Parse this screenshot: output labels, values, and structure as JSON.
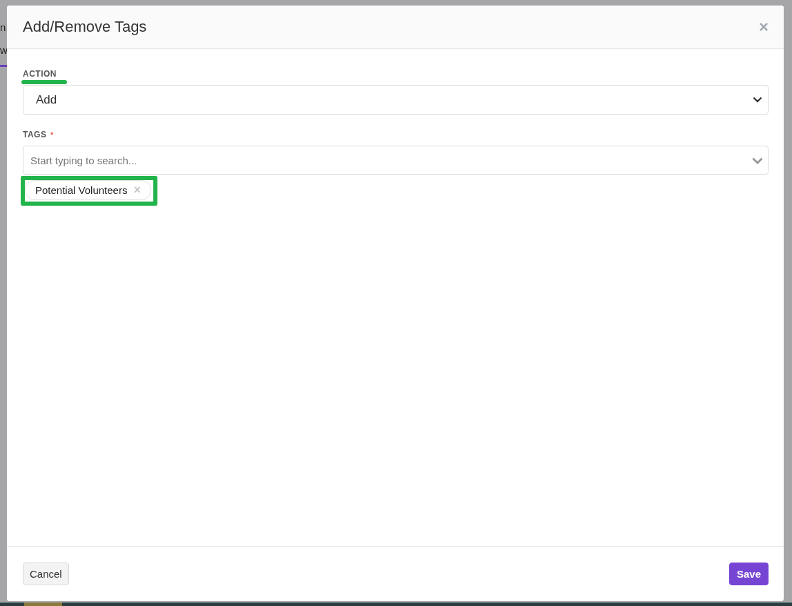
{
  "background": {
    "fragments": [
      "n",
      "w"
    ]
  },
  "dialog": {
    "title": "Add/Remove Tags",
    "close": "×"
  },
  "action": {
    "label": "ACTION",
    "value": "Add"
  },
  "tags": {
    "label": "TAGS",
    "required_mark": "*",
    "placeholder": "Start typing to search...",
    "selected": [
      {
        "label": "Potential Volunteers",
        "remove": "×"
      }
    ]
  },
  "buttons": [
    {
      "label": "Cancel",
      "kind": "secondary"
    },
    {
      "label": "Save",
      "kind": "primary"
    }
  ]
}
